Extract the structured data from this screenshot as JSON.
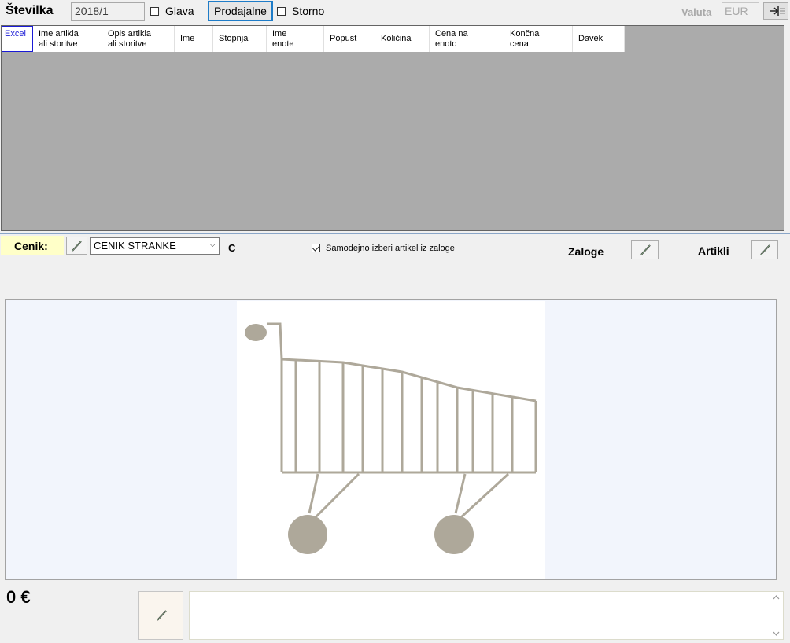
{
  "header": {
    "title": "Številka",
    "number_value": "2018/1",
    "glava_label": "Glava",
    "glava_checked": false,
    "prodajalne_label": "Prodajalne",
    "storno_label": "Storno",
    "storno_checked": false,
    "valuta_label": "Valuta",
    "valuta_value": "EUR"
  },
  "grid": {
    "columns": [
      "Excel",
      "Ime artikla\nali storitve",
      "Opis artikla\nali storitve",
      "Ime",
      "Stopnja",
      "Ime\nenote",
      "Popust",
      "Količina",
      "Cena na\nenoto",
      "Končna\ncena",
      "Davek"
    ],
    "rows": []
  },
  "cenik": {
    "label": "Cenik:",
    "selected": "CENIK STRANKE",
    "code": "C",
    "auto_select_label": "Samodejno izberi artikel iz zaloge",
    "auto_select_checked": true,
    "zaloge_label": "Zaloge",
    "artikli_label": "Artikli"
  },
  "image_panel": {
    "icon": "shopping-cart-icon"
  },
  "footer": {
    "total": "0 €",
    "memo": ""
  },
  "colors": {
    "grid_bg": "#ababab",
    "cenik_label_bg": "#ffffc8",
    "cart_color": "#aea89a",
    "accent_border": "#1e7cc8"
  }
}
